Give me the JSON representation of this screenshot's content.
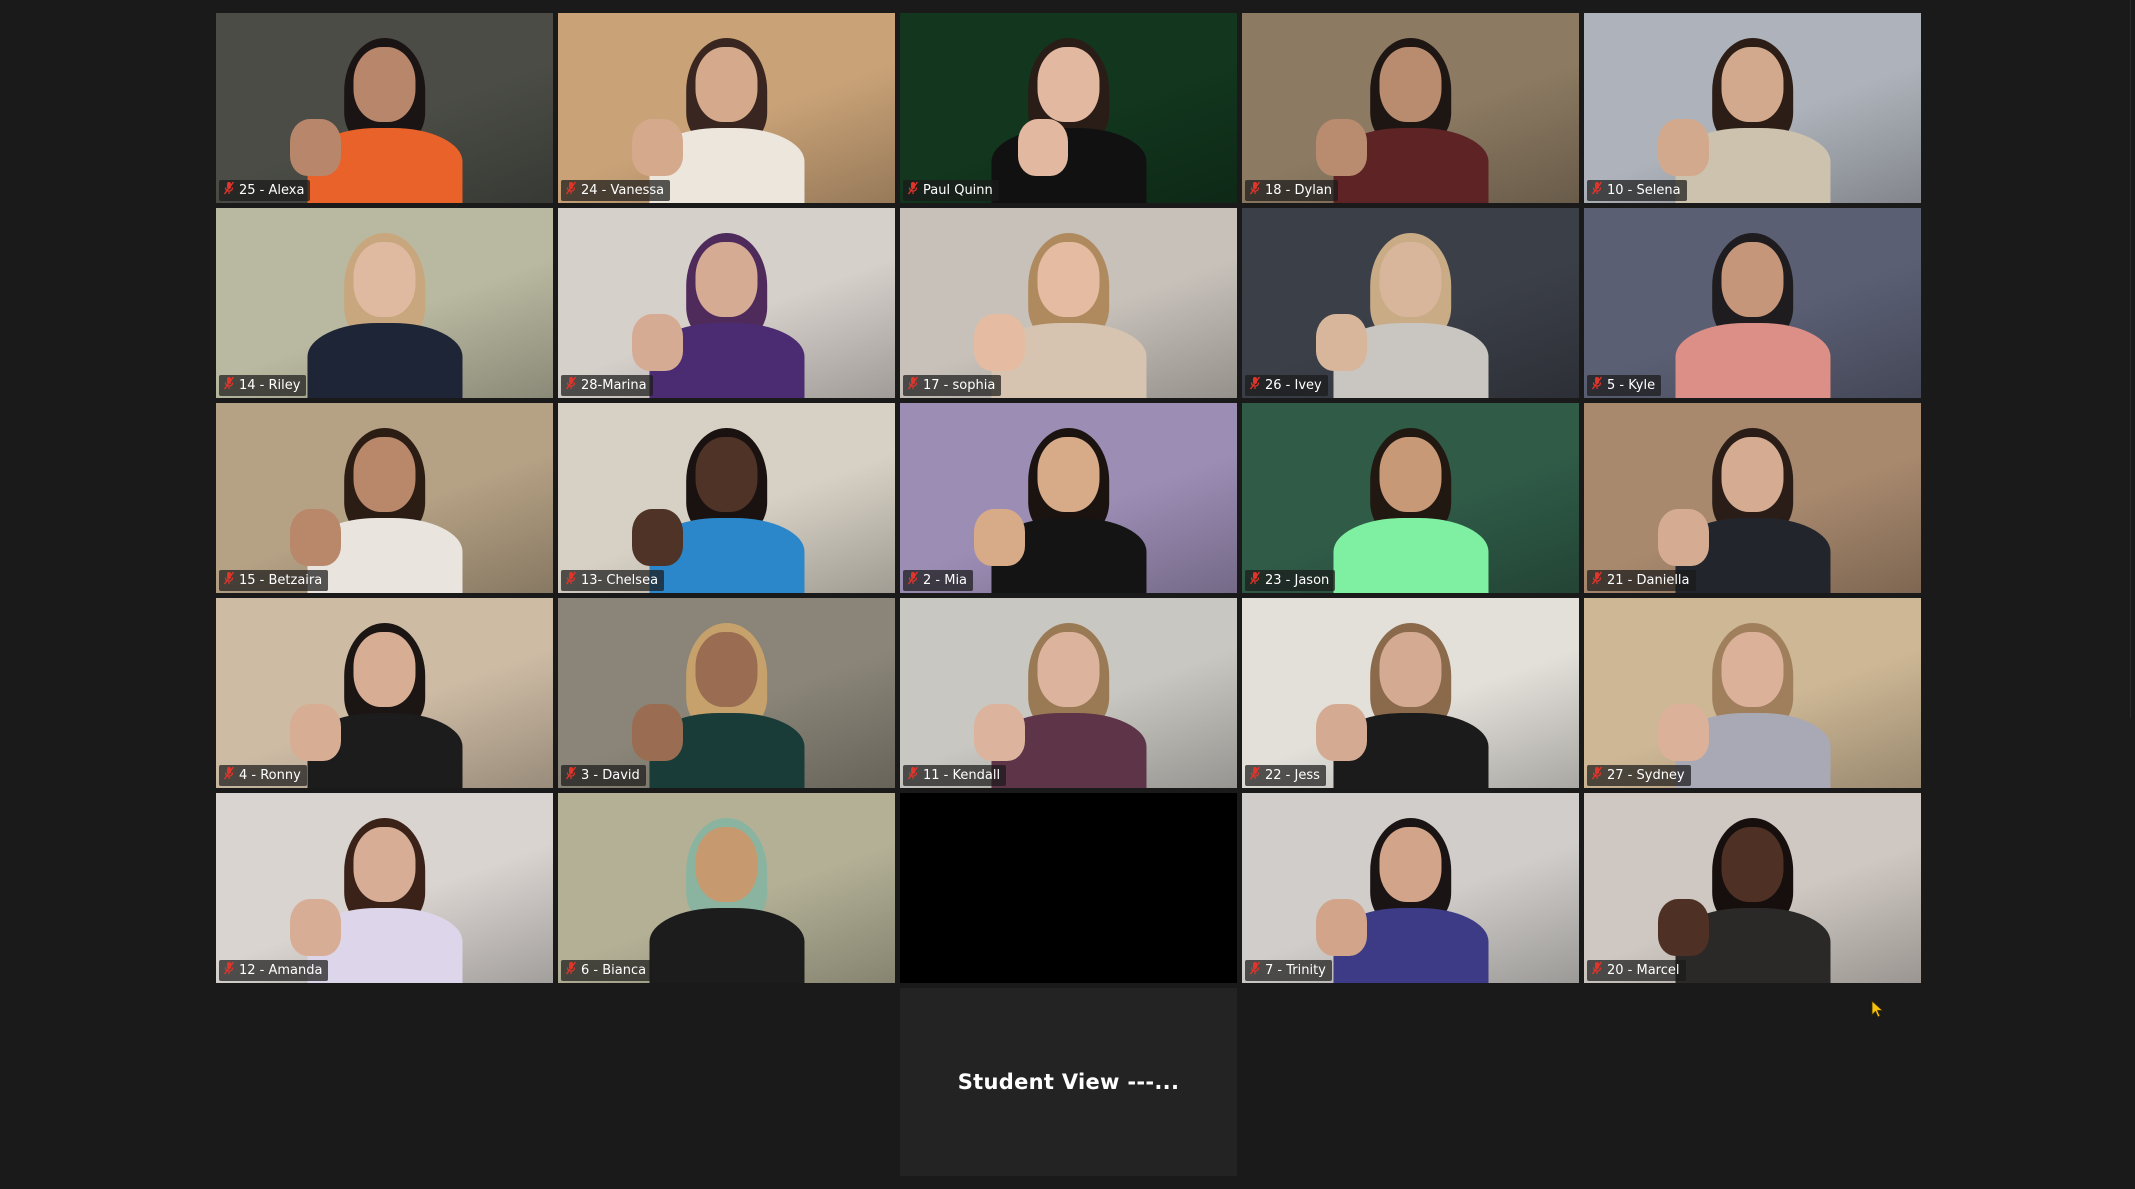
{
  "app": {
    "view": "Gallery View"
  },
  "colors": {
    "background": "#1a1a1a",
    "active_speaker_border": "#e4ef8a",
    "muted_icon": "#e0352b",
    "cursor": "#f4c20d"
  },
  "participants": [
    {
      "name": "25 - Alexa",
      "muted": true,
      "bg": "#4a4c45",
      "skin": "#b8866a",
      "hair": "#1b1414",
      "shirt": "#e8622a",
      "hand": true
    },
    {
      "name": "24 - Vanessa",
      "muted": true,
      "bg": "#c9a277",
      "skin": "#d5a98b",
      "hair": "#3a2620",
      "shirt": "#ece6dc",
      "hand": true
    },
    {
      "name": "Paul Quinn",
      "muted": true,
      "active": true,
      "bg": "#12361e",
      "skin": "#e2b8a0",
      "hair": "#2a1c16",
      "shirt": "#111111",
      "hand": true
    },
    {
      "name": "18 - Dylan",
      "muted": true,
      "bg": "#8c7a62",
      "skin": "#b98c70",
      "hair": "#1e1612",
      "shirt": "#5e2324",
      "hand": true
    },
    {
      "name": "10 - Selena",
      "muted": true,
      "bg": "#aeb3bb",
      "skin": "#d2a98c",
      "hair": "#2c1e17",
      "shirt": "#ccc2ae",
      "hand": true
    },
    {
      "name": "14 - Riley",
      "muted": true,
      "bg": "#b9b8a0",
      "skin": "#e0b9a1",
      "hair": "#c9a77e",
      "shirt": "#1e2536",
      "hand": false
    },
    {
      "name": "28-Marina",
      "muted": true,
      "bg": "#d6d0cb",
      "skin": "#d6ab94",
      "hair": "#4f2b5c",
      "shirt": "#4b2c72",
      "hand": true
    },
    {
      "name": "17 - sophia",
      "muted": true,
      "bg": "#c7c1ba",
      "skin": "#e5bca1",
      "hair": "#b08a5f",
      "shirt": "#d6c4b0",
      "hand": true
    },
    {
      "name": "26 - Ivey",
      "muted": true,
      "bg": "#3b3f48",
      "skin": "#d7b69c",
      "hair": "#c9ab86",
      "shirt": "#c9c6c1",
      "hand": true
    },
    {
      "name": "5 - Kyle",
      "muted": true,
      "bg": "#5b5f74",
      "skin": "#c6967a",
      "hair": "#1e1c1e",
      "shirt": "#db8f86",
      "hand": false
    },
    {
      "name": "15 - Betzaira",
      "muted": true,
      "bg": "#b5a184",
      "skin": "#b9876a",
      "hair": "#2b1c14",
      "shirt": "#e9e4dd",
      "hand": true
    },
    {
      "name": "13- Chelsea",
      "muted": true,
      "bg": "#d7d1c5",
      "skin": "#4e3326",
      "hair": "#1a1210",
      "shirt": "#2b87c9",
      "hand": true
    },
    {
      "name": "2 - Mia",
      "muted": true,
      "bg": "#9c8db5",
      "skin": "#d7aa88",
      "hair": "#1b1310",
      "shirt": "#141414",
      "hand": true
    },
    {
      "name": "23 - Jason",
      "muted": true,
      "bg": "#2f5b47",
      "skin": "#c79977",
      "hair": "#221812",
      "shirt": "#7ff0a2",
      "hand": false
    },
    {
      "name": "21 - Daniella",
      "muted": true,
      "bg": "#a8896e",
      "skin": "#d5ab92",
      "hair": "#2a1d17",
      "shirt": "#23252d",
      "hand": true
    },
    {
      "name": "4 - Ronny",
      "muted": true,
      "bg": "#cdbba4",
      "skin": "#d7ad94",
      "hair": "#1b1514",
      "shirt": "#1d1c1d",
      "hand": true
    },
    {
      "name": "3 - David",
      "muted": true,
      "bg": "#8a8578",
      "skin": "#9a6d52",
      "hair": "#c6a16c",
      "shirt": "#193c39",
      "hand": true
    },
    {
      "name": "11 - Kendall",
      "muted": true,
      "bg": "#c9c7c1",
      "skin": "#dcb39c",
      "hair": "#9a7a54",
      "shirt": "#5d3448",
      "hand": true
    },
    {
      "name": "22 - Jess",
      "muted": true,
      "bg": "#e3e0da",
      "skin": "#d4ab92",
      "hair": "#8a6a4a",
      "shirt": "#1b1b1b",
      "hand": true
    },
    {
      "name": "27 - Sydney",
      "muted": true,
      "bg": "#cdb795",
      "skin": "#dbb19a",
      "hair": "#a0805c",
      "shirt": "#a9a9b6",
      "hand": true
    },
    {
      "name": "12 - Amanda",
      "muted": true,
      "bg": "#d9d4d0",
      "skin": "#d8ad95",
      "hair": "#3a2218",
      "shirt": "#ddd6ea",
      "hand": true
    },
    {
      "name": "6 - Bianca",
      "muted": true,
      "bg": "#b3b096",
      "skin": "#c6996f",
      "hair": "#8bb4a0",
      "shirt": "#1c1c1c",
      "hand": false
    },
    {
      "name": "",
      "muted": false,
      "blank": true
    },
    {
      "name": "7 - Trinity",
      "muted": true,
      "bg": "#d0cdca",
      "skin": "#d2a58a",
      "hair": "#1a1414",
      "shirt": "#3d3a86",
      "hand": true
    },
    {
      "name": "20 - Marcel",
      "muted": true,
      "bg": "#cfc8c2",
      "skin": "#4e3124",
      "hair": "#160f0d",
      "shirt": "#2a2927",
      "hand": true
    }
  ],
  "student_view": {
    "label": "Student View ---..."
  }
}
